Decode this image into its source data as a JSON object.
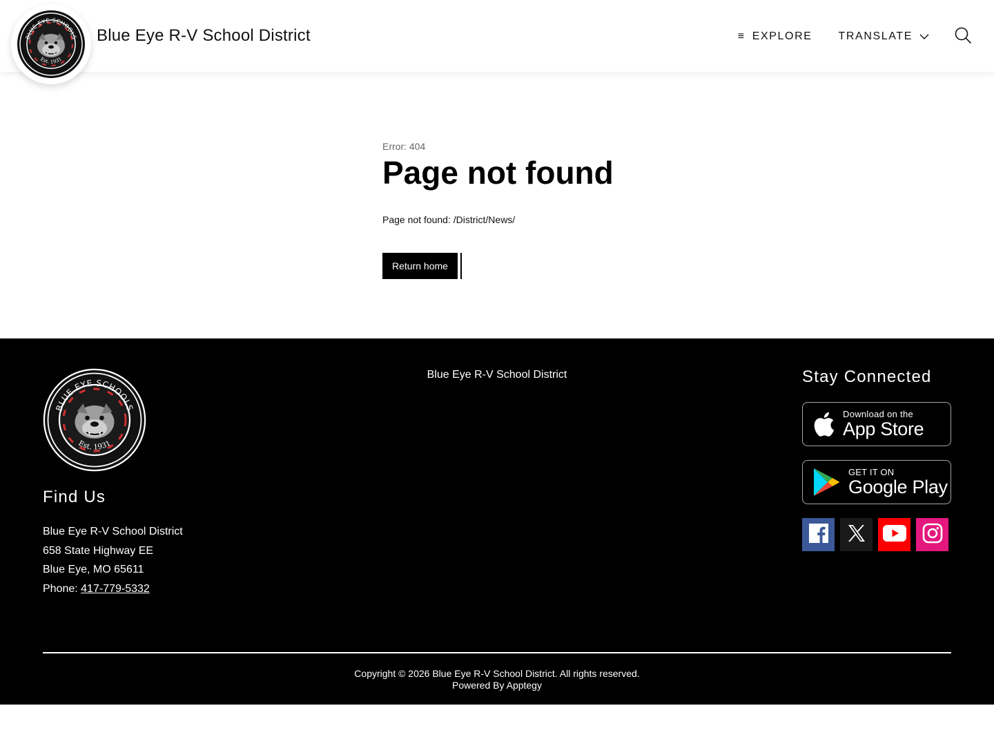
{
  "header": {
    "title": "Blue Eye R-V School District",
    "logo": {
      "ring_text_top": "BLUE EYE SCHOOLS",
      "ring_text_bottom": "Est. 1931"
    },
    "nav": {
      "explore": "EXPLORE",
      "translate": "TRANSLATE"
    },
    "icons": {
      "menu": "hamburger-icon",
      "translate_caret": "chevron-down-icon",
      "search": "search-icon"
    }
  },
  "main": {
    "error_code": "Error: 404",
    "title": "Page not found",
    "message": "Page not found: /District/News/",
    "return_button": "Return home"
  },
  "footer": {
    "logo": {
      "ring_text_top": "BLUE EYE SCHOOLS",
      "ring_text_bottom": "Est. 1931"
    },
    "find_us_title": "Find Us",
    "address": {
      "name": "Blue Eye R-V School District",
      "street": "658 State Highway EE",
      "city": "Blue Eye, MO 65611",
      "phone_label": "Phone: ",
      "phone": "417-779-5332"
    },
    "center_name": "Blue Eye R-V School District",
    "stay_connected_title": "Stay Connected",
    "app_store": {
      "small": "Download on the",
      "big": "App Store"
    },
    "google_play": {
      "small": "GET IT ON",
      "big": "Google Play"
    },
    "social": {
      "facebook": "facebook-icon",
      "x": "x-icon",
      "youtube": "youtube-icon",
      "instagram": "instagram-icon"
    },
    "copyright": "Copyright © 2026 Blue Eye R-V School District. All rights reserved.",
    "powered_by": "Powered By Apptegy"
  },
  "colors": {
    "footer_bg": "#000000",
    "facebook": "#3b5998",
    "x": "#1a1a1a",
    "youtube": "#ff0000",
    "instagram": "#e4177e",
    "logo_accent": "#d32f2f"
  }
}
